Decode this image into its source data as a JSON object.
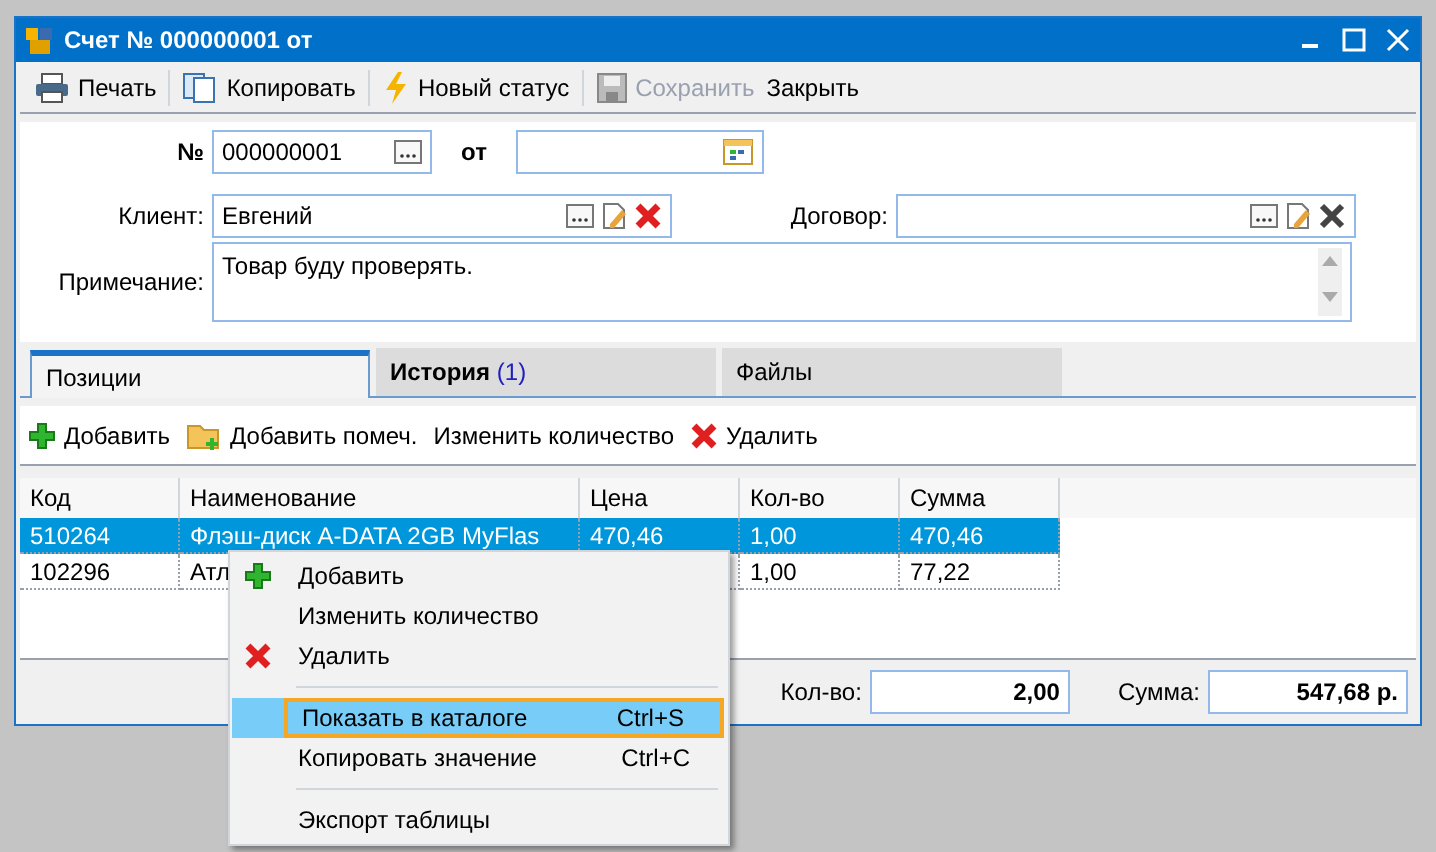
{
  "window": {
    "title": "Счет № 000000001 от"
  },
  "toolbar": [
    {
      "label": "Печать",
      "disabled": false
    },
    {
      "label": "Копировать",
      "disabled": false
    },
    {
      "label": "Новый статус",
      "disabled": false
    },
    {
      "label": "Сохранить",
      "disabled": true
    },
    {
      "label": "Закрыть",
      "disabled": false
    }
  ],
  "form": {
    "number_label": "№",
    "number": "000000001",
    "date_label": "от",
    "client_label": "Клиент:",
    "client": "Евгений",
    "contract_label": "Договор:",
    "note_label": "Примечание:",
    "note": "Товар буду проверять."
  },
  "tabs": [
    {
      "label": "Позиции",
      "selected": true
    },
    {
      "label": "История",
      "count": "(1)",
      "selected": false
    },
    {
      "label": "Файлы",
      "selected": false
    }
  ],
  "actions": [
    {
      "label": "Добавить"
    },
    {
      "label": "Добавить помеч."
    },
    {
      "label": "Изменить количество"
    },
    {
      "label": "Удалить"
    }
  ],
  "table": {
    "columns": [
      "Код",
      "Наименование",
      "Цена",
      "Кол-во",
      "Сумма"
    ],
    "rows": [
      {
        "cells": [
          "510264",
          "Флэш-диск A-DATA 2GB MyFlas",
          "470,46",
          "1,00",
          "470,46"
        ],
        "selected": true
      },
      {
        "cells": [
          "102296",
          "Атл",
          "",
          "1,00",
          "77,22"
        ],
        "selected": false
      }
    ]
  },
  "totals": {
    "qty_label": "Кол-во:",
    "qty": "2,00",
    "sum_label": "Сумма:",
    "sum": "547,68 р."
  },
  "context_menu": [
    {
      "kind": "item",
      "label": "Добавить",
      "selected": false
    },
    {
      "kind": "item",
      "label": "Изменить количество",
      "selected": false
    },
    {
      "kind": "item",
      "label": "Удалить",
      "selected": false
    },
    {
      "kind": "separator"
    },
    {
      "kind": "item",
      "label": "Показать в каталоге",
      "shortcut": "Ctrl+S",
      "selected": true
    },
    {
      "kind": "item",
      "label": "Копировать значение",
      "shortcut": "Ctrl+C",
      "selected": false
    },
    {
      "kind": "separator"
    },
    {
      "kind": "item",
      "label": "Экспорт таблицы",
      "selected": false
    }
  ]
}
